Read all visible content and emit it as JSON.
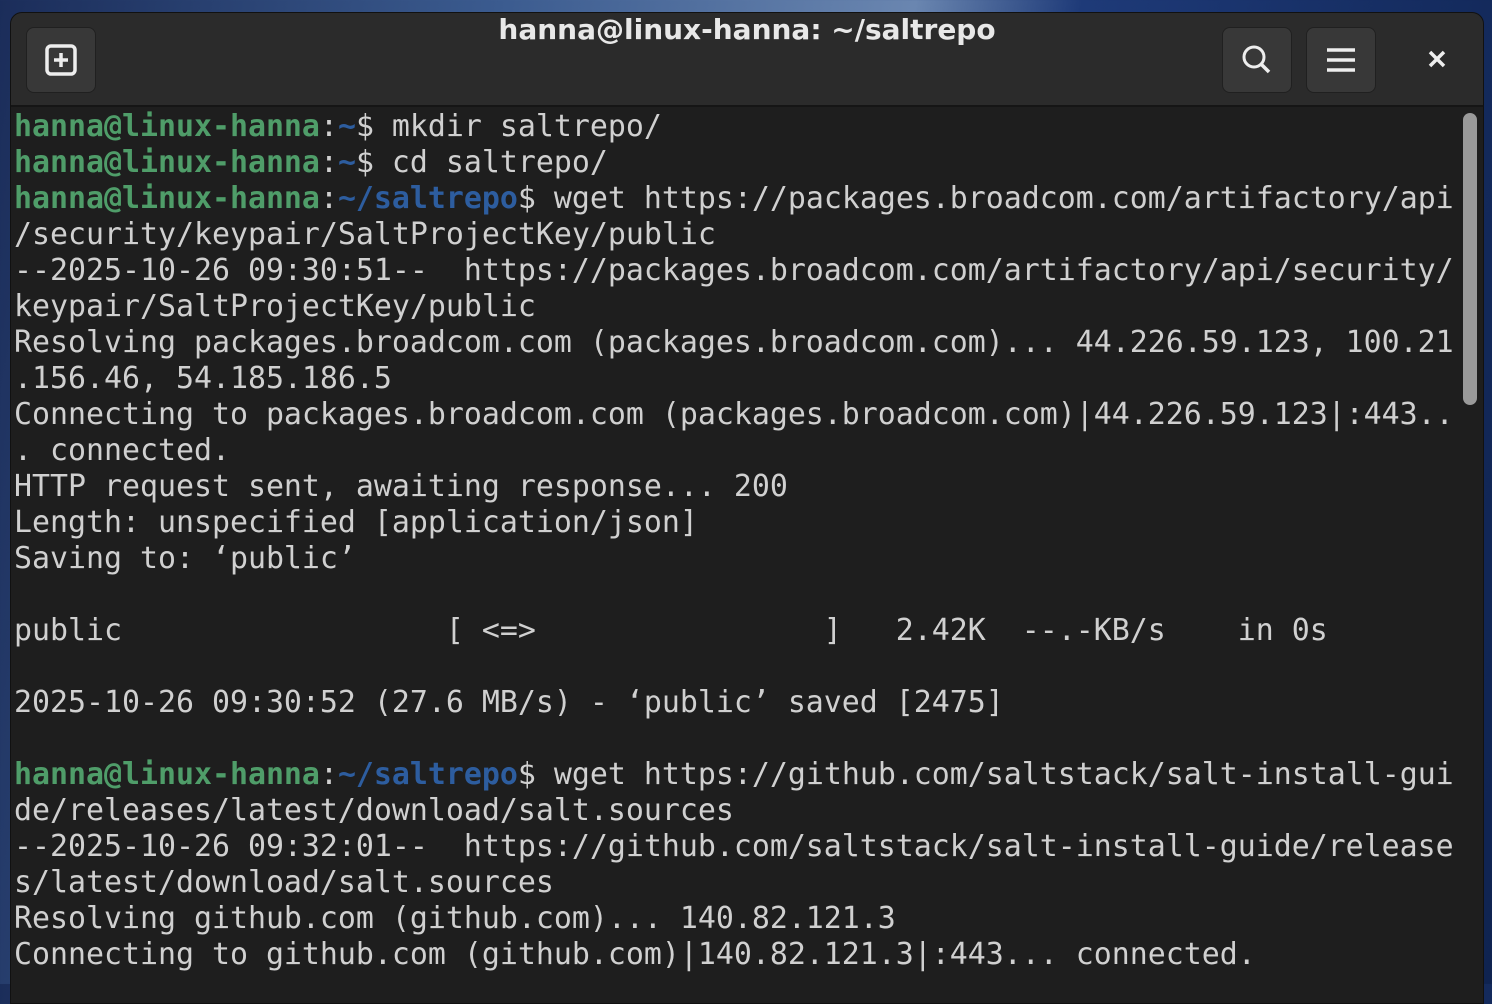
{
  "window": {
    "title": "hanna@linux-hanna: ~/saltrepo"
  },
  "header": {
    "new_tab_icon": "plus-square-icon",
    "search_icon": "search-icon",
    "menu_icon": "hamburger-menu-icon",
    "close_icon": "close-icon"
  },
  "terminal": {
    "lines": [
      {
        "user": "hanna@linux-hanna",
        "sep": ":",
        "path": "~",
        "text": "$ mkdir saltrepo/"
      },
      {
        "user": "hanna@linux-hanna",
        "sep": ":",
        "path": "~",
        "text": "$ cd saltrepo/"
      },
      {
        "user": "hanna@linux-hanna",
        "sep": ":",
        "path": "~/saltrepo",
        "text": "$ wget https://packages.broadcom.com/artifactory/api"
      },
      {
        "text": "/security/keypair/SaltProjectKey/public"
      },
      {
        "text": "--2025-10-26 09:30:51--  https://packages.broadcom.com/artifactory/api/security/"
      },
      {
        "text": "keypair/SaltProjectKey/public"
      },
      {
        "text": "Resolving packages.broadcom.com (packages.broadcom.com)... 44.226.59.123, 100.21"
      },
      {
        "text": ".156.46, 54.185.186.5"
      },
      {
        "text": "Connecting to packages.broadcom.com (packages.broadcom.com)|44.226.59.123|:443.."
      },
      {
        "text": ". connected."
      },
      {
        "text": "HTTP request sent, awaiting response... 200"
      },
      {
        "text": "Length: unspecified [application/json]"
      },
      {
        "text": "Saving to: ‘public’"
      },
      {
        "text": ""
      },
      {
        "text": "public                  [ <=>                ]   2.42K  --.-KB/s    in 0s"
      },
      {
        "text": ""
      },
      {
        "text": "2025-10-26 09:30:52 (27.6 MB/s) - ‘public’ saved [2475]"
      },
      {
        "text": ""
      },
      {
        "user": "hanna@linux-hanna",
        "sep": ":",
        "path": "~/saltrepo",
        "text": "$ wget https://github.com/saltstack/salt-install-gui"
      },
      {
        "text": "de/releases/latest/download/salt.sources"
      },
      {
        "text": "--2025-10-26 09:32:01--  https://github.com/saltstack/salt-install-guide/release"
      },
      {
        "text": "s/latest/download/salt.sources"
      },
      {
        "text": "Resolving github.com (github.com)... 140.82.121.3"
      },
      {
        "text": "Connecting to github.com (github.com)|140.82.121.3|:443... connected."
      }
    ]
  }
}
